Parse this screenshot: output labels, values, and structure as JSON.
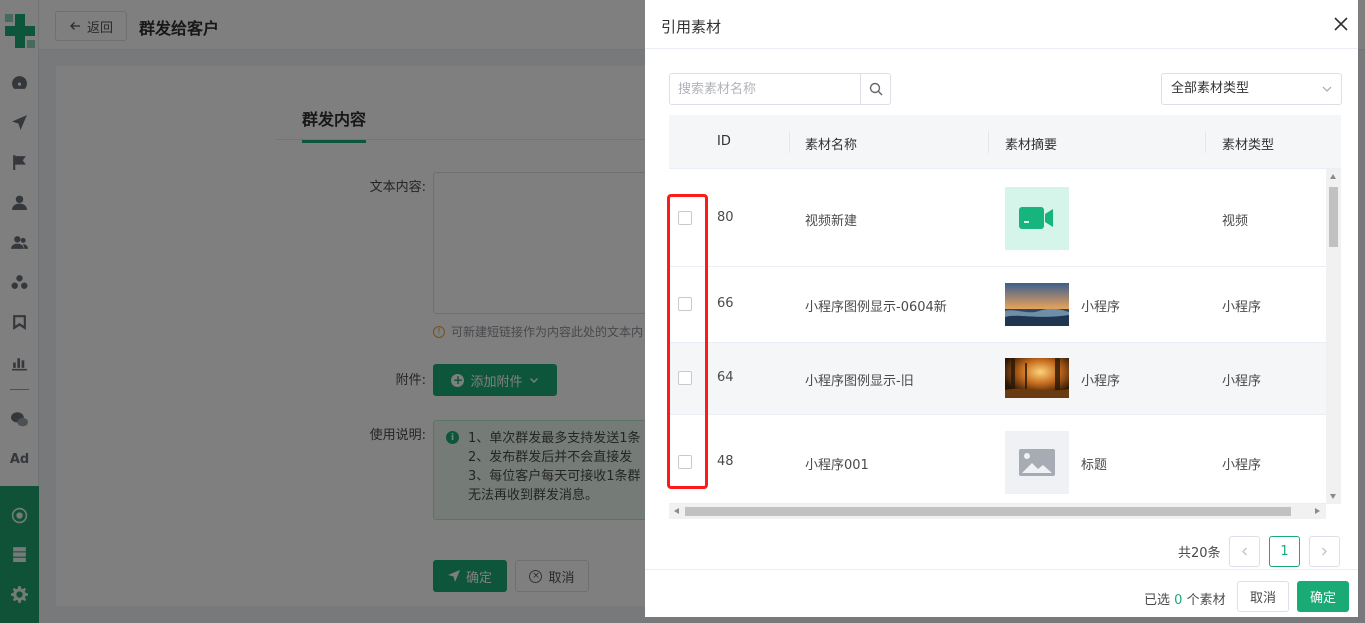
{
  "background": {
    "back_label": "返回",
    "page_title": "群发给客户",
    "section_title": "群发内容",
    "text_label": "文本内容:",
    "hint_text": "可新建短链接作为内容此处的文本内",
    "attach_label": "附件:",
    "attach_button": "添加附件",
    "usage_label": "使用说明:",
    "notice_lines": [
      "1、单次群发最多支持发送1条",
      "2、发布群发后并不会直接发",
      "3、每位客户每天可接收1条群",
      "无法再收到群发消息。"
    ],
    "confirm_label": "确定",
    "cancel_label": "取消"
  },
  "rail": {
    "icons": [
      "dashboard-icon",
      "send-icon",
      "flag-icon",
      "user-icon",
      "users-icon",
      "group-icon",
      "bookmark-icon",
      "chart-icon",
      "wechat-icon"
    ],
    "ad_label": "Ad",
    "bottom_icons": [
      "hub-icon",
      "storage-icon",
      "gear-icon"
    ]
  },
  "drawer": {
    "title": "引用素材",
    "search_placeholder": "搜索素材名称",
    "type_select_value": "全部素材类型",
    "columns": [
      "ID",
      "素材名称",
      "素材摘要",
      "素材类型"
    ],
    "rows": [
      {
        "id": "80",
        "name": "视频新建",
        "summary": "",
        "type": "视频",
        "thumb": "video-thumbnail"
      },
      {
        "id": "66",
        "name": "小程序图例显示-0604新",
        "summary": "小程序",
        "type": "小程序",
        "thumb": "lake-sunset-thumbnail"
      },
      {
        "id": "64",
        "name": "小程序图例显示-旧",
        "summary": "小程序",
        "type": "小程序",
        "thumb": "forest-thumbnail"
      },
      {
        "id": "48",
        "name": "小程序001",
        "summary": "标题",
        "type": "小程序",
        "thumb": "image-placeholder-thumbnail"
      }
    ],
    "total_text": "共20条",
    "current_page": "1",
    "selected_prefix": "已选",
    "selected_count": "0",
    "selected_suffix": "个素材",
    "cancel_label": "取消",
    "ok_label": "确定"
  },
  "colors": {
    "accent": "#1aaa76",
    "highlight": "#ff1a1a"
  }
}
